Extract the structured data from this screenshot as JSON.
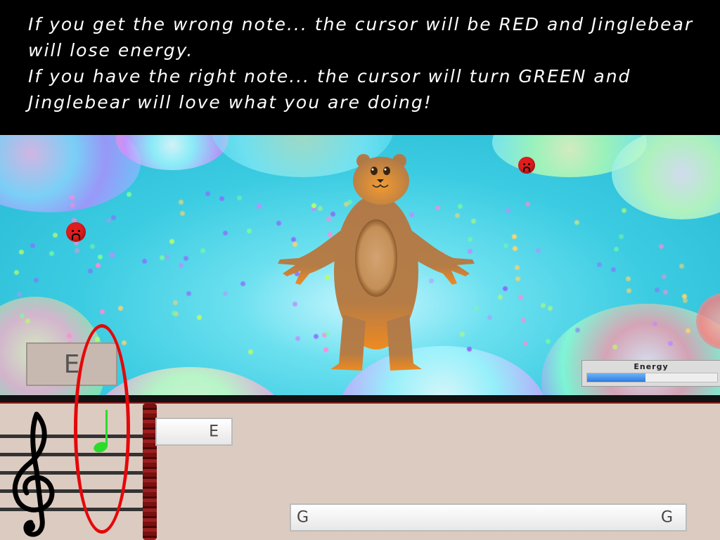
{
  "instructions": {
    "line1": "If you get the wrong note... the cursor will be RED and Jinglebear will lose energy.",
    "line2": "If you have the right note... the cursor will turn GREEN and Jinglebear will love what you are doing!"
  },
  "scene": {
    "current_note": "E",
    "energy_label": "Energy",
    "energy_level": 0.45
  },
  "staff": {
    "note_bar_1_left": "",
    "note_bar_1_right": "E",
    "note_bar_2_left": "G",
    "note_bar_2_right": "G"
  },
  "colors": {
    "correct_cursor": "#2bdc2b",
    "highlight": "#e4080a",
    "energy_fill": "#2c7be0"
  }
}
